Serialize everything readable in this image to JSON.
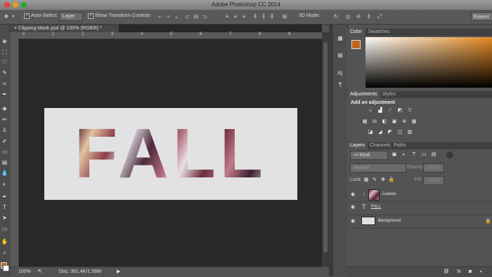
{
  "app": {
    "title": "Adobe Photoshop CC 2014"
  },
  "options_bar": {
    "auto_select_label": "Auto-Select:",
    "auto_select_value": "Layer",
    "show_transform_label": "Show Transform Controls",
    "three_d_mode_label": "3D Mode:",
    "workspace_label": "Essent"
  },
  "document": {
    "tab_label": "Clipping-Mask.psd @ 100% (RGB/8) *",
    "canvas_text": "FALL",
    "ruler_numbers": [
      "0",
      "1",
      "2",
      "3",
      "4",
      "5",
      "6",
      "7",
      "8",
      "9"
    ]
  },
  "status_bar": {
    "zoom": "100%",
    "doc_info": "Doc: 361.4K/1.56M"
  },
  "color_panel": {
    "tabs": [
      "Color",
      "Swatches"
    ],
    "foreground_color": "#c2651a",
    "ramp_color": "#e48a22"
  },
  "adjustments_panel": {
    "tabs": [
      "Adjustments",
      "Styles"
    ],
    "heading": "Add an adjustment"
  },
  "layers_panel": {
    "tabs": [
      "Layers",
      "Channels",
      "Paths"
    ],
    "kind_filter": "Kind",
    "blend_mode": "Normal",
    "opacity_label": "Opacity:",
    "opacity_value": "100%",
    "lock_label": "Lock:",
    "fill_label": "Fill:",
    "fill_value": "100%",
    "layers": [
      {
        "name": "Leaves"
      },
      {
        "name": "FALL"
      },
      {
        "name": "Background"
      }
    ]
  }
}
